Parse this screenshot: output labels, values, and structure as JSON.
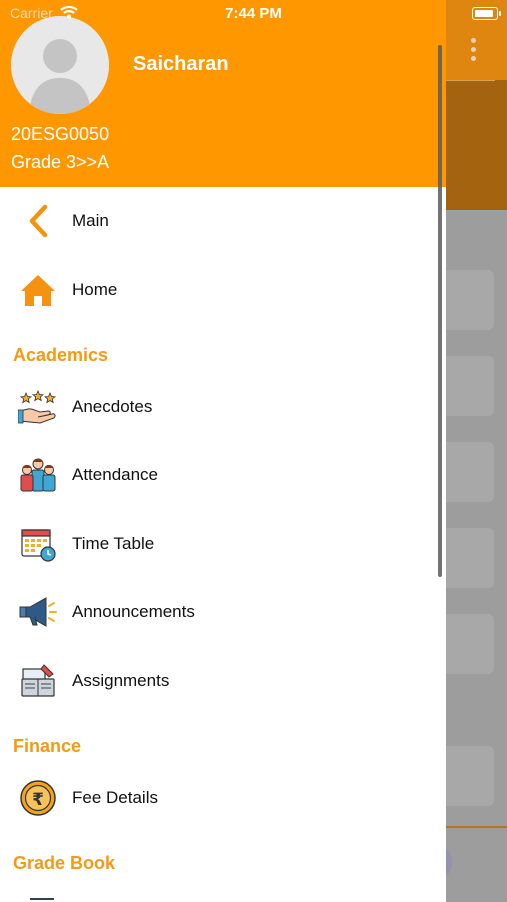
{
  "status_bar": {
    "carrier": "Carrier",
    "time": "7:44 PM"
  },
  "profile": {
    "name": "Saicharan",
    "id": "20ESG0050",
    "grade": "Grade 3>>A"
  },
  "menu": {
    "main": "Main",
    "home": "Home",
    "academics_header": "Academics",
    "academics": [
      {
        "label": "Anecdotes",
        "icon": "anecdotes-icon"
      },
      {
        "label": "Attendance",
        "icon": "attendance-icon"
      },
      {
        "label": "Time Table",
        "icon": "timetable-icon"
      },
      {
        "label": "Announcements",
        "icon": "megaphone-icon"
      },
      {
        "label": "Assignments",
        "icon": "assignments-icon"
      }
    ],
    "finance_header": "Finance",
    "finance": [
      {
        "label": "Fee Details",
        "icon": "rupee-coin-icon"
      }
    ],
    "gradebook_header": "Grade Book"
  },
  "colors": {
    "accent": "#ff9700",
    "section": "#f59a13"
  }
}
